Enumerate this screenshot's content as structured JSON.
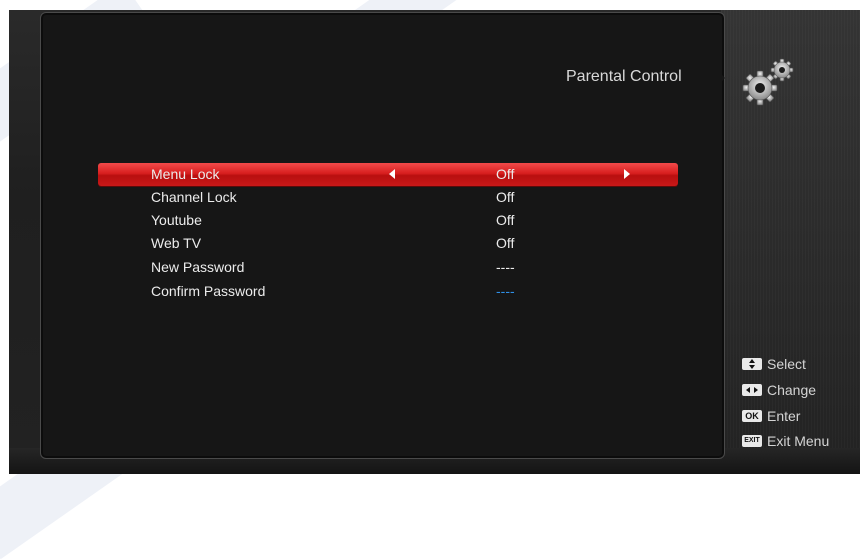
{
  "header": {
    "title": "Parental Control"
  },
  "menu": {
    "items": [
      {
        "label": "Menu Lock",
        "value": "Off"
      },
      {
        "label": "Channel Lock",
        "value": "Off"
      },
      {
        "label": "Youtube",
        "value": "Off"
      },
      {
        "label": "Web TV",
        "value": "Off"
      },
      {
        "label": "New Password",
        "value": "----"
      },
      {
        "label": "Confirm Password",
        "value": "----"
      }
    ]
  },
  "legend": {
    "select": {
      "key": "",
      "label": "Select"
    },
    "change": {
      "key": "",
      "label": "Change"
    },
    "enter": {
      "key": "OK",
      "label": "Enter"
    },
    "exit": {
      "key": "EXIT",
      "label": "Exit Menu"
    }
  },
  "colors": {
    "selection": "#d81f1f",
    "password_entry": "#2f8fe6",
    "panel": "#161616"
  },
  "icons": [
    "gears-icon",
    "arrow-left-icon",
    "arrow-right-icon",
    "up-down-key-icon",
    "left-right-key-icon",
    "ok-key-icon",
    "exit-key-icon"
  ]
}
